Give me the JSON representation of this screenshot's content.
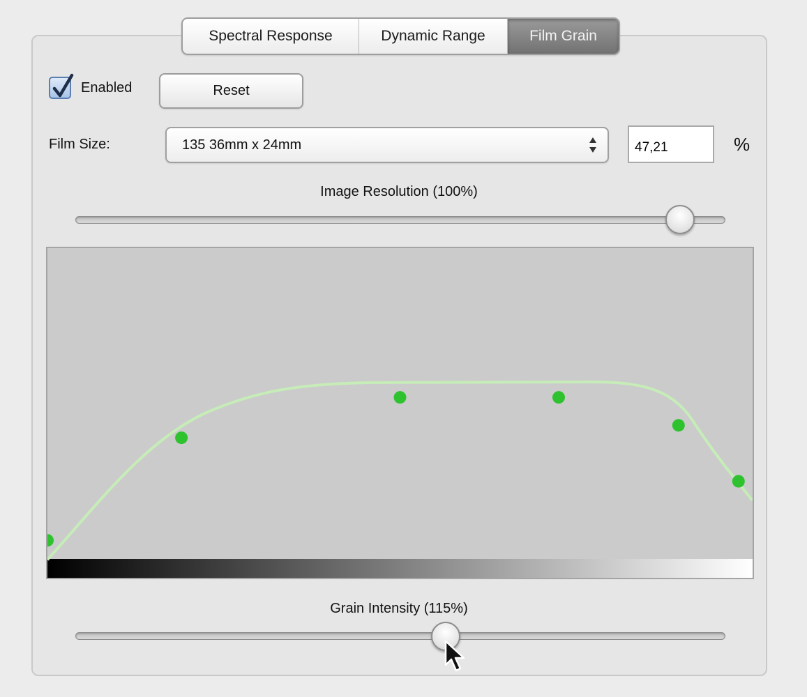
{
  "tabs": [
    {
      "label": "Spectral Response",
      "active": false
    },
    {
      "label": "Dynamic Range",
      "active": false
    },
    {
      "label": "Film Grain",
      "active": true
    }
  ],
  "enabled": {
    "label": "Enabled",
    "checked": true
  },
  "reset_label": "Reset",
  "film_size": {
    "label": "Film Size:",
    "selected": "135 36mm x 24mm",
    "value": "47,21",
    "unit": "%"
  },
  "image_resolution": {
    "label": "Image Resolution (100%)",
    "value": 0.93
  },
  "grain_intensity": {
    "label": "Grain Intensity (115%)",
    "value": 0.57
  },
  "grain_curve": {
    "curve_color": "#c6ecb8",
    "point_color": "#2ec22e",
    "points": [
      {
        "x": 0.0,
        "y": 0.06
      },
      {
        "x": 0.19,
        "y": 0.39
      },
      {
        "x": 0.5,
        "y": 0.52
      },
      {
        "x": 0.725,
        "y": 0.52
      },
      {
        "x": 0.895,
        "y": 0.43
      },
      {
        "x": 0.98,
        "y": 0.25
      }
    ]
  },
  "colors": {
    "active_tab": "#7d7d7d",
    "checkbox_blue": "#5b7fb2",
    "panel_bg": "#e6e6e6"
  }
}
